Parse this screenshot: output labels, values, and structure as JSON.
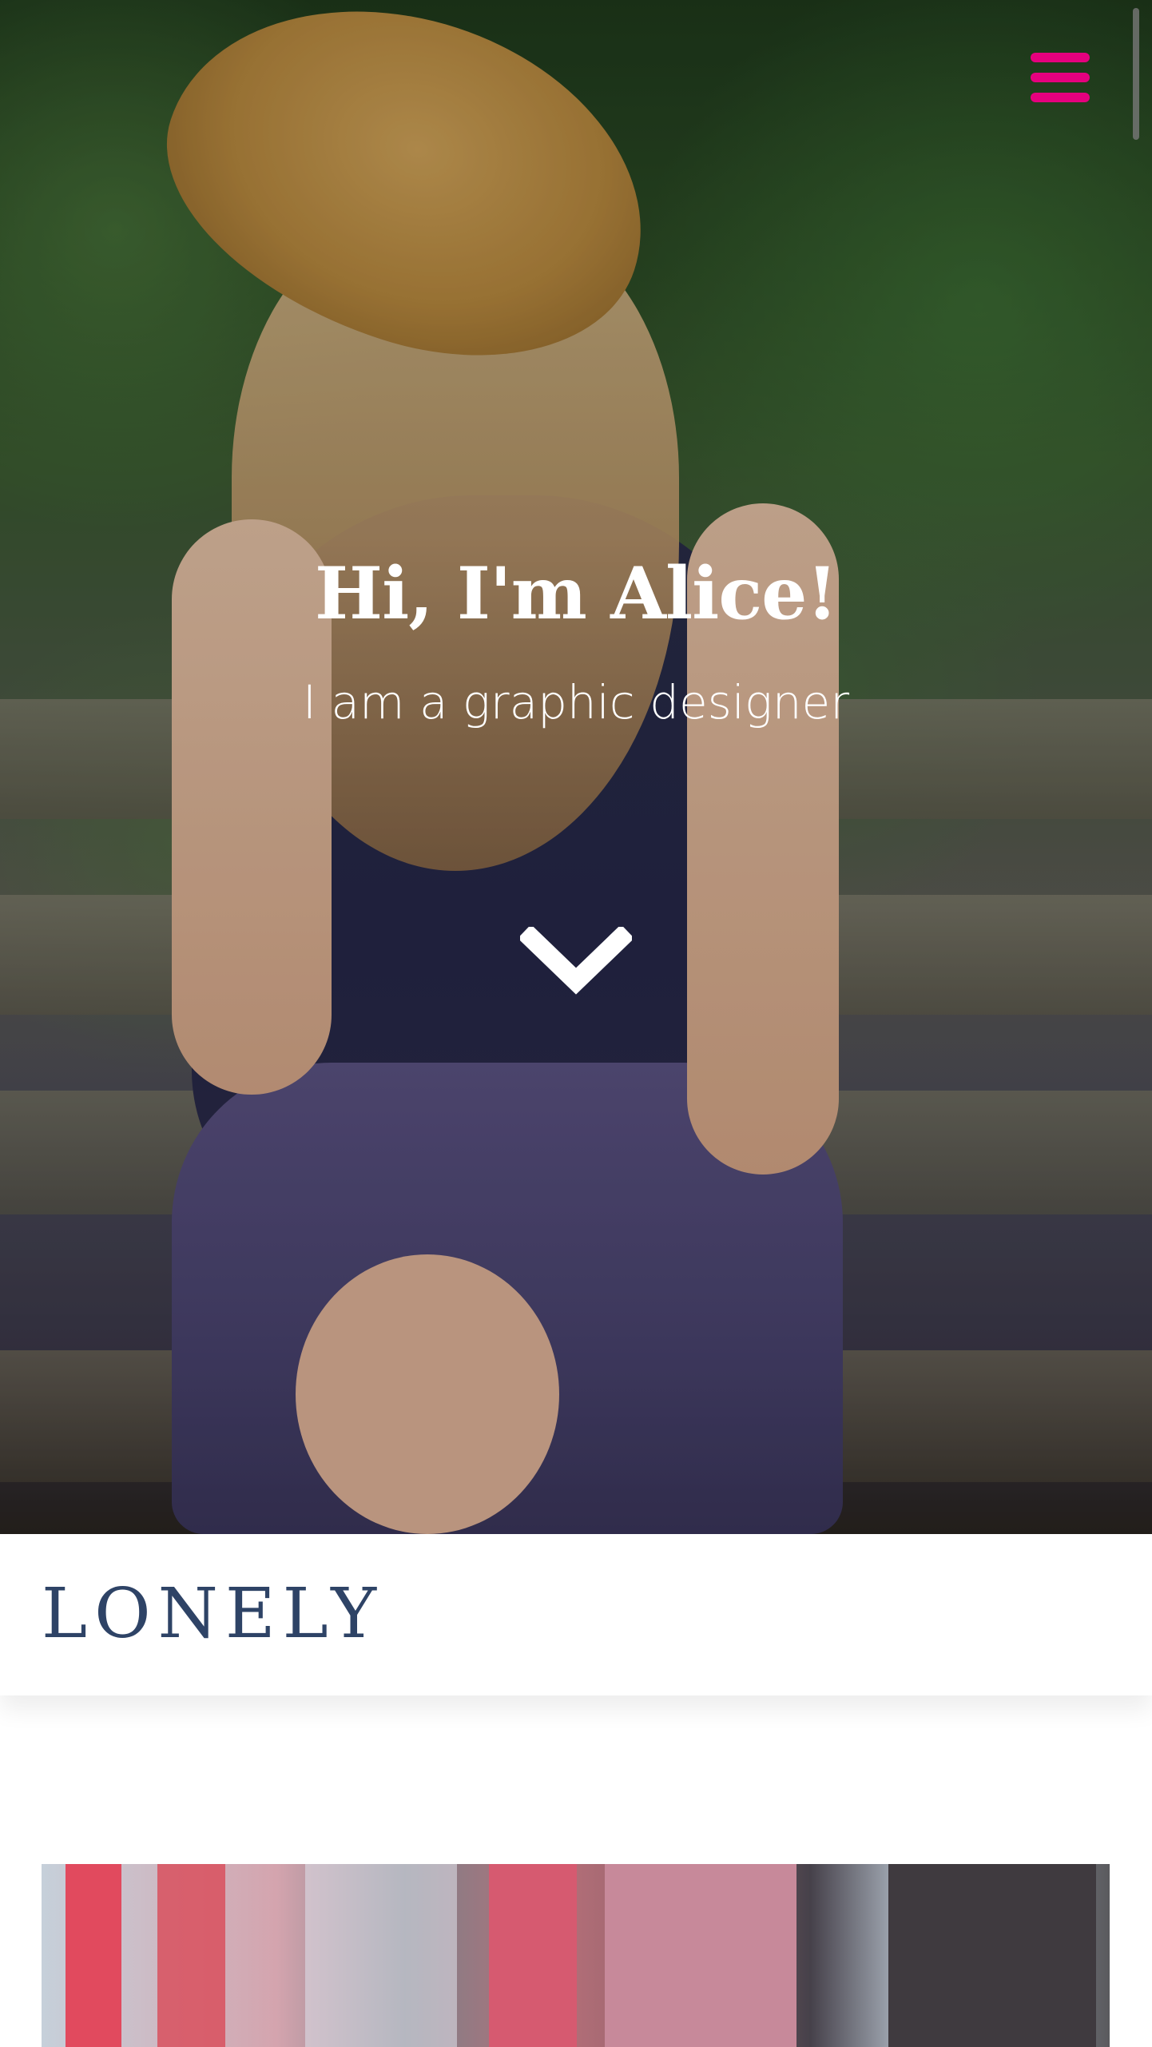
{
  "hero": {
    "title": "Hi, I'm Alice!",
    "subtitle": "I am a graphic designer"
  },
  "header": {
    "brand": "LONELY"
  },
  "icons": {
    "menu": "hamburger-menu-icon",
    "scroll": "chevron-down-icon"
  },
  "colors": {
    "accent": "#e5007e",
    "brand_text": "#2e4366",
    "hero_text": "#ffffff"
  }
}
